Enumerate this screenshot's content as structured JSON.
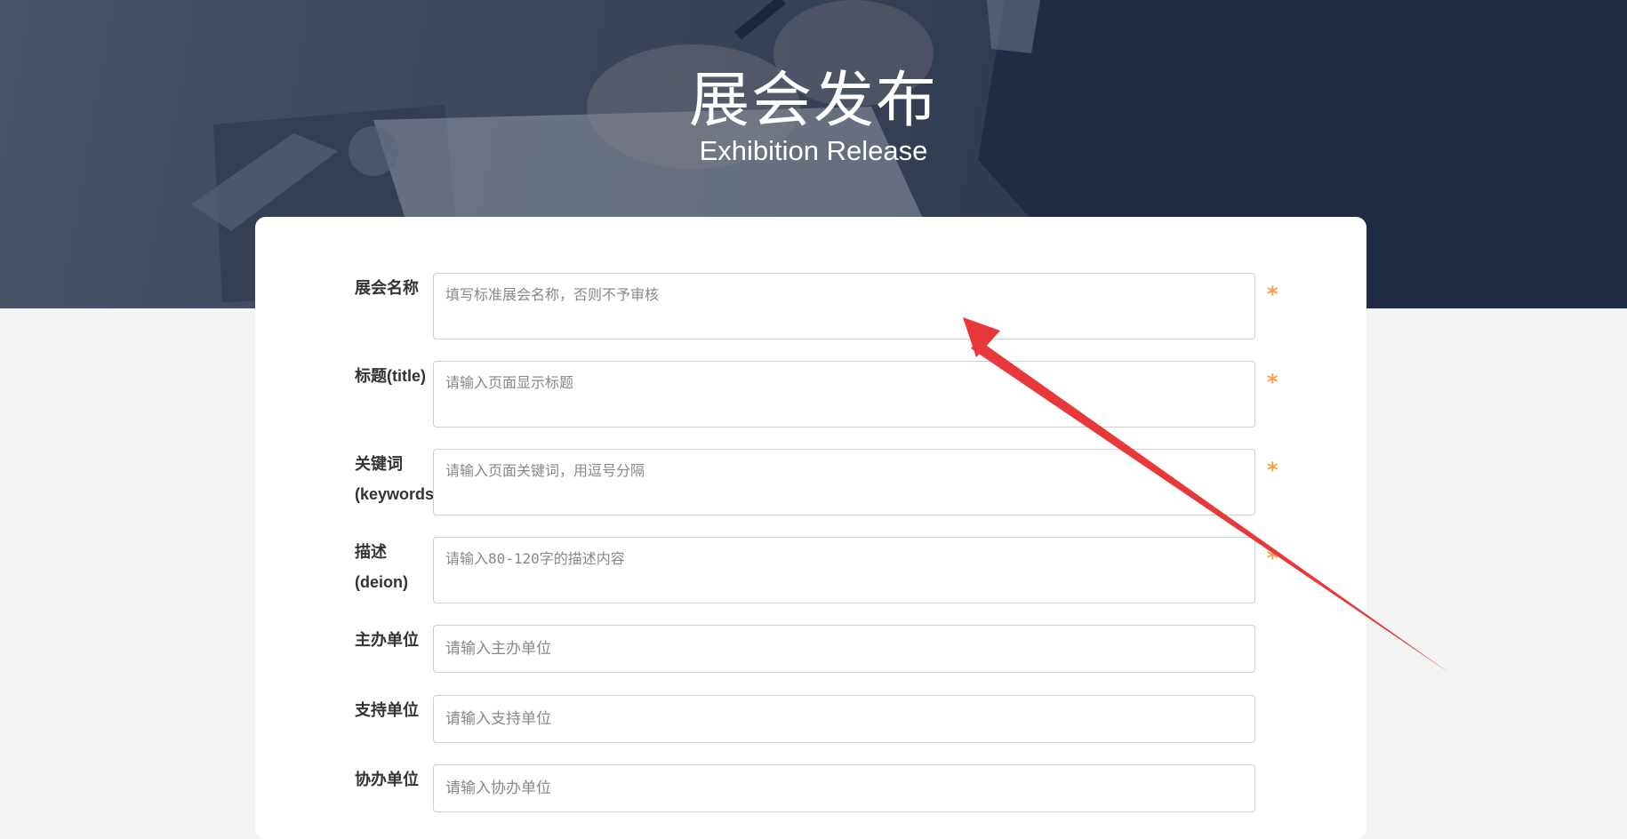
{
  "hero": {
    "title": "展会发布",
    "subtitle": "Exhibition Release"
  },
  "form": {
    "required_mark": "*",
    "fields": [
      {
        "label": "展会名称",
        "placeholder": "填写标准展会名称，否则不予审核",
        "value": "",
        "required": true
      },
      {
        "label": "标题(title)",
        "placeholder": "请输入页面显示标题",
        "value": "",
        "required": true
      },
      {
        "label": "关键词(keywords)",
        "placeholder": "请输入页面关键词，用逗号分隔",
        "value": "",
        "required": true
      },
      {
        "label": "描述(deion)",
        "placeholder": "请输入80-120字的描述内容",
        "value": "",
        "required": true
      },
      {
        "label": "主办单位",
        "placeholder": "请输入主办单位",
        "value": "",
        "required": false
      },
      {
        "label": "支持单位",
        "placeholder": "请输入支持单位",
        "value": "",
        "required": false
      },
      {
        "label": "协办单位",
        "placeholder": "请输入协办单位",
        "value": "",
        "required": false
      }
    ]
  },
  "colors": {
    "required_mark": "#f5a14a",
    "annotation_arrow": "#e8383a",
    "hero_overlay": "#2b3750"
  }
}
